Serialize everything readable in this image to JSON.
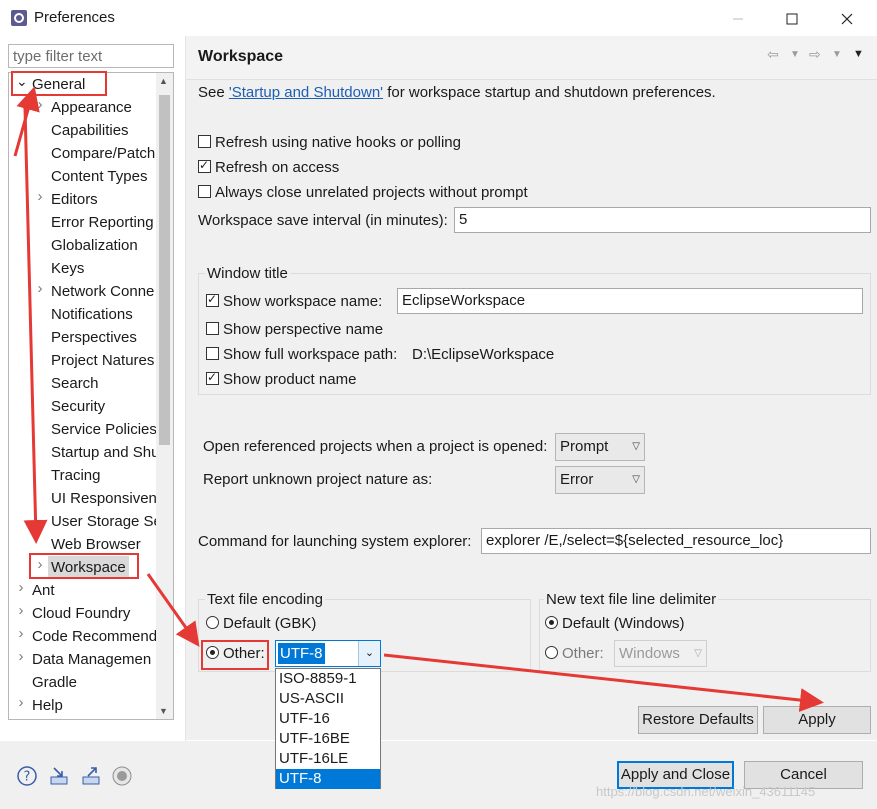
{
  "window": {
    "title": "Preferences"
  },
  "filter": {
    "placeholder": "type filter text"
  },
  "tree": {
    "items": [
      {
        "label": "General",
        "level": 0,
        "expanded": true
      },
      {
        "label": "Appearance",
        "level": 1,
        "expandable": true
      },
      {
        "label": "Capabilities",
        "level": 1
      },
      {
        "label": "Compare/Patch",
        "level": 1
      },
      {
        "label": "Content Types",
        "level": 1
      },
      {
        "label": "Editors",
        "level": 1,
        "expandable": true
      },
      {
        "label": "Error Reporting",
        "level": 1
      },
      {
        "label": "Globalization",
        "level": 1
      },
      {
        "label": "Keys",
        "level": 1
      },
      {
        "label": "Network Conne",
        "level": 1,
        "expandable": true
      },
      {
        "label": "Notifications",
        "level": 1
      },
      {
        "label": "Perspectives",
        "level": 1
      },
      {
        "label": "Project Natures",
        "level": 1
      },
      {
        "label": "Search",
        "level": 1
      },
      {
        "label": "Security",
        "level": 1
      },
      {
        "label": "Service Policies",
        "level": 1
      },
      {
        "label": "Startup and Shu",
        "level": 1
      },
      {
        "label": "Tracing",
        "level": 1
      },
      {
        "label": "UI Responsiven",
        "level": 1
      },
      {
        "label": "User Storage Se",
        "level": 1
      },
      {
        "label": "Web Browser",
        "level": 1
      },
      {
        "label": "Workspace",
        "level": 1,
        "expandable": true,
        "selected": true
      },
      {
        "label": "Ant",
        "level": 0,
        "expandable": true
      },
      {
        "label": "Cloud Foundry",
        "level": 0,
        "expandable": true
      },
      {
        "label": "Code Recommend",
        "level": 0,
        "expandable": true
      },
      {
        "label": "Data Managemen",
        "level": 0,
        "expandable": true
      },
      {
        "label": "Gradle",
        "level": 0
      },
      {
        "label": "Help",
        "level": 0,
        "expandable": true
      }
    ]
  },
  "page": {
    "title": "Workspace",
    "intro_prefix": "See ",
    "intro_link": "'Startup and Shutdown'",
    "intro_suffix": " for workspace startup and shutdown preferences.",
    "refresh_native": {
      "label": "Refresh using native hooks or polling",
      "checked": false
    },
    "refresh_access": {
      "label": "Refresh on access",
      "checked": true
    },
    "always_close": {
      "label": "Always close unrelated projects without prompt",
      "checked": false
    },
    "save_interval": {
      "label": "Workspace save interval (in minutes):",
      "value": "5"
    },
    "window_title": {
      "group_label": "Window title",
      "show_ws_name": {
        "label": "Show workspace name:",
        "checked": true,
        "value": "EclipseWorkspace"
      },
      "show_perspective": {
        "label": "Show perspective name",
        "checked": false
      },
      "show_full_path": {
        "label": "Show full workspace path:",
        "checked": false,
        "value": "D:\\EclipseWorkspace"
      },
      "show_product": {
        "label": "Show product name",
        "checked": true
      }
    },
    "open_referenced": {
      "label": "Open referenced projects when a project is opened:",
      "value": "Prompt"
    },
    "report_unknown": {
      "label": "Report unknown project nature as:",
      "value": "Error"
    },
    "explorer_cmd": {
      "label": "Command for launching system explorer:",
      "value": "explorer /E,/select=${selected_resource_loc}"
    },
    "encoding": {
      "group_label": "Text file encoding",
      "default_label": "Default (GBK)",
      "other_label": "Other:",
      "other_value": "UTF-8",
      "options": [
        "ISO-8859-1",
        "US-ASCII",
        "UTF-16",
        "UTF-16BE",
        "UTF-16LE",
        "UTF-8"
      ],
      "selected": "UTF-8"
    },
    "delimiter": {
      "group_label": "New text file line delimiter",
      "default_label": "Default (Windows)",
      "other_label": "Other:",
      "other_value": "Windows"
    }
  },
  "buttons": {
    "restore": "Restore Defaults",
    "apply": "Apply",
    "apply_close": "Apply and Close",
    "cancel": "Cancel"
  },
  "watermark": "https://blog.csdn.net/weixin_43611145",
  "colors": {
    "accent": "#0078d7",
    "annotation": "#e53935",
    "link": "#1e5fb3"
  }
}
